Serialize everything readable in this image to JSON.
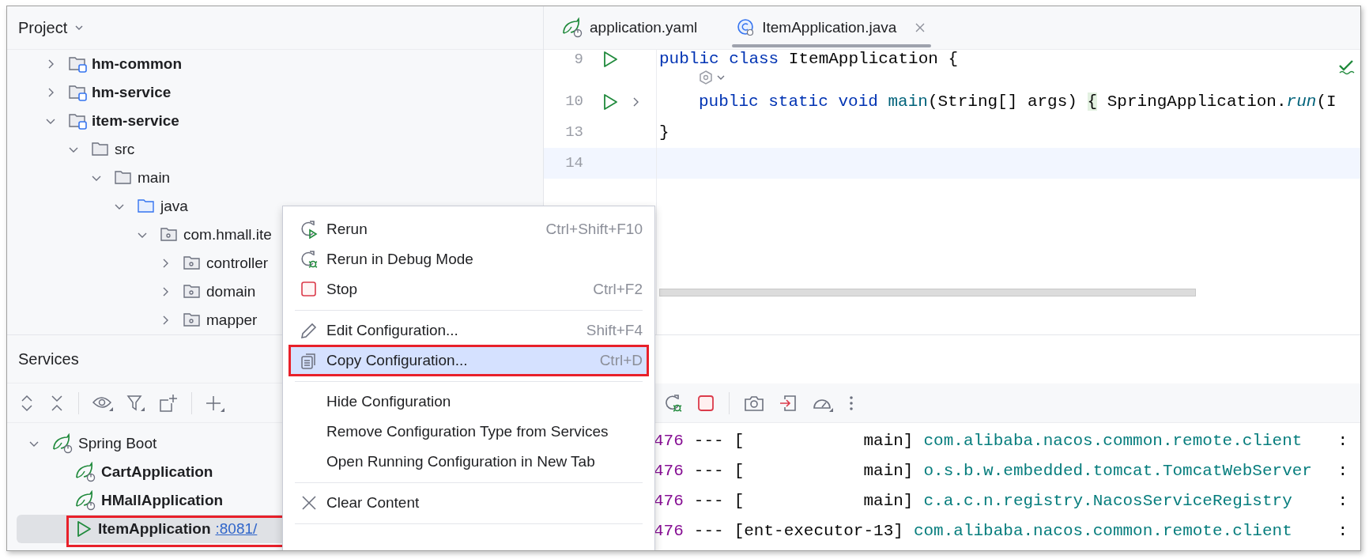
{
  "project": {
    "title": "Project",
    "tree": [
      {
        "label": "hm-common",
        "kind": "module",
        "expanded": false
      },
      {
        "label": "hm-service",
        "kind": "module",
        "expanded": false
      },
      {
        "label": "item-service",
        "kind": "module",
        "expanded": true,
        "children": [
          {
            "label": "src",
            "kind": "folder",
            "expanded": true,
            "children": [
              {
                "label": "main",
                "kind": "folder",
                "expanded": true,
                "children": [
                  {
                    "label": "java",
                    "kind": "source",
                    "expanded": true,
                    "children": [
                      {
                        "label": "com.hmall.ite",
                        "kind": "package",
                        "expanded": true,
                        "children": [
                          {
                            "label": "controller",
                            "kind": "package",
                            "expanded": false
                          },
                          {
                            "label": "domain",
                            "kind": "package",
                            "expanded": false
                          },
                          {
                            "label": "mapper",
                            "kind": "package",
                            "expanded": false
                          }
                        ]
                      }
                    ]
                  }
                ]
              }
            ]
          }
        ]
      }
    ]
  },
  "editor": {
    "tabs": [
      {
        "label": "application.yaml",
        "kind": "yaml",
        "selected": false
      },
      {
        "label": "ItemApplication.java",
        "kind": "java",
        "selected": true
      }
    ],
    "lines": [
      {
        "kind": "code",
        "number": "9",
        "run": true,
        "foldable": false,
        "indented": false,
        "current": false,
        "tokens": [
          {
            "text": "public class ",
            "kind": "keyword"
          },
          {
            "text": "ItemApplication {",
            "kind": "plain"
          }
        ]
      },
      {
        "kind": "hint",
        "indented": true
      },
      {
        "kind": "code",
        "number": "10",
        "run": true,
        "foldable": true,
        "indented": true,
        "current": false,
        "tokens": [
          {
            "text": "public static void ",
            "kind": "keyword"
          },
          {
            "text": "main",
            "kind": "method"
          },
          {
            "text": "(String[] args) ",
            "kind": "plain"
          },
          {
            "text": "{",
            "kind": "folded"
          },
          {
            "text": " SpringApplication.",
            "kind": "plain"
          },
          {
            "text": "run",
            "kind": "static"
          },
          {
            "text": "(I",
            "kind": "plain"
          }
        ]
      },
      {
        "kind": "code",
        "number": "13",
        "run": false,
        "foldable": false,
        "indented": false,
        "current": false,
        "tokens": [
          {
            "text": "}",
            "kind": "plain"
          }
        ]
      },
      {
        "kind": "code",
        "number": "14",
        "run": false,
        "foldable": false,
        "current": true
      }
    ]
  },
  "services": {
    "title": "Services",
    "tree": [
      {
        "label": "Spring Boot",
        "kind": "group",
        "expanded": true,
        "selected": false,
        "outlined": false,
        "children": [
          {
            "label": "CartApplication",
            "kind": "spring",
            "selected": false,
            "outlined": false
          },
          {
            "label": "HMallApplication",
            "kind": "spring",
            "selected": false,
            "outlined": false
          },
          {
            "label": "ItemApplication",
            "port": ":8081/",
            "kind": "running",
            "selected": true,
            "outlined": true
          }
        ]
      }
    ]
  },
  "console": {
    "lines": [
      {
        "pid": "476",
        "dashes": "---",
        "thread": "[            main]",
        "logger": "com.alibaba.nacos.common.remote.client",
        "colon": ":"
      },
      {
        "pid": "476",
        "dashes": "---",
        "thread": "[            main]",
        "logger": "o.s.b.w.embedded.tomcat.TomcatWebServer",
        "colon": ":"
      },
      {
        "pid": "476",
        "dashes": "---",
        "thread": "[            main]",
        "logger": "c.a.c.n.registry.NacosServiceRegistry",
        "colon": ":"
      },
      {
        "pid": "476",
        "dashes": "---",
        "thread": "[ent-executor-13]",
        "logger": "com.alibaba.nacos.common.remote.client",
        "colon": ":"
      }
    ]
  },
  "context_menu": {
    "items": [
      {
        "kind": "rerun",
        "label": "Rerun",
        "shortcut": "Ctrl+Shift+F10",
        "selected": false,
        "outlined": false
      },
      {
        "kind": "debug",
        "label": "Rerun in Debug Mode",
        "selected": false,
        "outlined": false
      },
      {
        "kind": "stop",
        "label": "Stop",
        "shortcut": "Ctrl+F2",
        "selected": false,
        "outlined": false
      },
      {
        "kind": "separator"
      },
      {
        "kind": "edit",
        "label": "Edit Configuration...",
        "shortcut": "Shift+F4",
        "selected": false,
        "outlined": false
      },
      {
        "kind": "copy",
        "label": "Copy Configuration...",
        "shortcut": "Ctrl+D",
        "selected": true,
        "outlined": true
      },
      {
        "kind": "separator"
      },
      {
        "kind": "plain",
        "label": "Hide Configuration",
        "selected": false,
        "outlined": false
      },
      {
        "kind": "plain",
        "label": "Remove Configuration Type from Services",
        "selected": false,
        "outlined": false
      },
      {
        "kind": "plain",
        "label": "Open Running Configuration in New Tab",
        "selected": false,
        "outlined": false
      },
      {
        "kind": "separator"
      },
      {
        "kind": "clear",
        "label": "Clear Content",
        "selected": false,
        "outlined": false
      },
      {
        "kind": "separator"
      }
    ]
  }
}
